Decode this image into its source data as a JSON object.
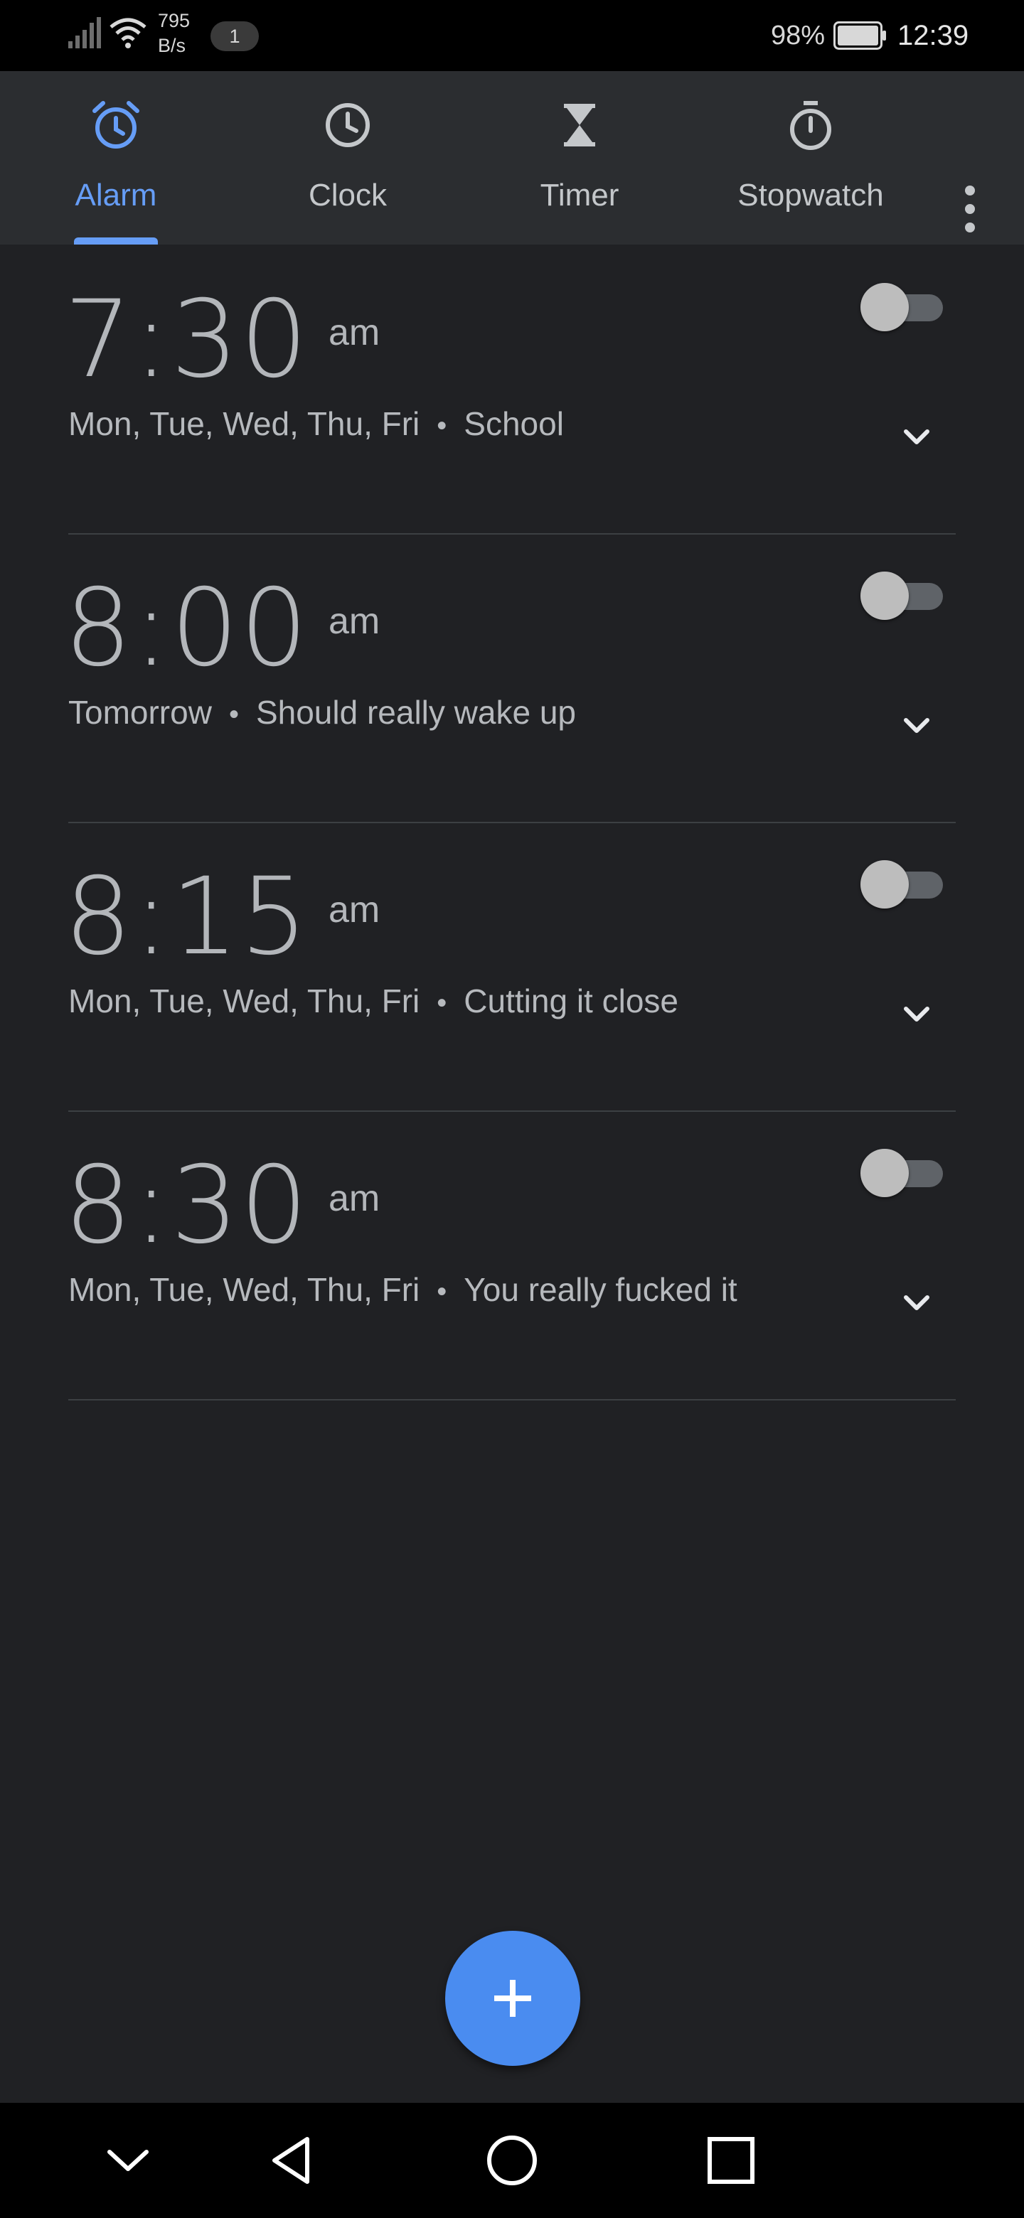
{
  "status_bar": {
    "net_speed_value": "795",
    "net_speed_unit": "B/s",
    "notification_count": "1",
    "battery_percent": "98%",
    "time": "12:39"
  },
  "tabs": [
    {
      "label": "Alarm",
      "icon": "alarm-icon",
      "active": true
    },
    {
      "label": "Clock",
      "icon": "clock-icon",
      "active": false
    },
    {
      "label": "Timer",
      "icon": "hourglass-icon",
      "active": false
    },
    {
      "label": "Stopwatch",
      "icon": "stopwatch-icon",
      "active": false
    }
  ],
  "alarms": [
    {
      "time": "7:30",
      "ampm": "am",
      "days": "Mon, Tue, Wed, Thu, Fri",
      "label": "School",
      "enabled": false
    },
    {
      "time": "8:00",
      "ampm": "am",
      "days": "Tomorrow",
      "label": "Should really wake up",
      "enabled": false
    },
    {
      "time": "8:15",
      "ampm": "am",
      "days": "Mon, Tue, Wed, Thu, Fri",
      "label": "Cutting it close",
      "enabled": false
    },
    {
      "time": "8:30",
      "ampm": "am",
      "days": "Mon, Tue, Wed, Thu, Fri",
      "label": "You really fucked it",
      "enabled": false
    }
  ],
  "colors": {
    "background": "#202124",
    "tab_bar": "#2b2d30",
    "accent": "#669df6",
    "fab": "#4a8cf0"
  }
}
